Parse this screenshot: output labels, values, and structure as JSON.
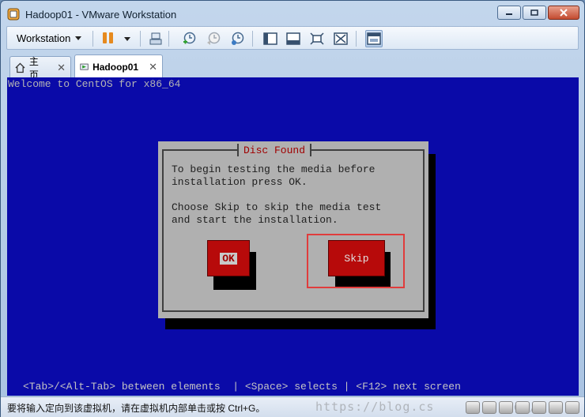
{
  "window": {
    "title": "Hadoop01 - VMware Workstation"
  },
  "toolbar": {
    "workstation_label": "Workstation"
  },
  "tabs": [
    {
      "label": "主页"
    },
    {
      "label": "Hadoop01"
    }
  ],
  "console": {
    "welcome": "Welcome to CentOS for x86_64",
    "dialog": {
      "title": "Disc Found",
      "line1": "To begin testing the media before",
      "line2": "installation press OK.",
      "line3": "Choose Skip to skip the media test",
      "line4": "and start the installation.",
      "ok_label": "OK",
      "skip_label": "Skip"
    },
    "hint": "<Tab>/<Alt-Tab> between elements  | <Space> selects | <F12> next screen"
  },
  "status": {
    "text": "要将输入定向到该虚拟机，请在虚拟机内部单击或按 Ctrl+G。",
    "watermark": "https://blog.cs         net/"
  },
  "colors": {
    "console_bg": "#0a0aa8",
    "dialog_bg": "#b0b0b0",
    "button_red": "#b70a0a",
    "highlight": "#e03c3c",
    "pause": "#e68a1f"
  }
}
